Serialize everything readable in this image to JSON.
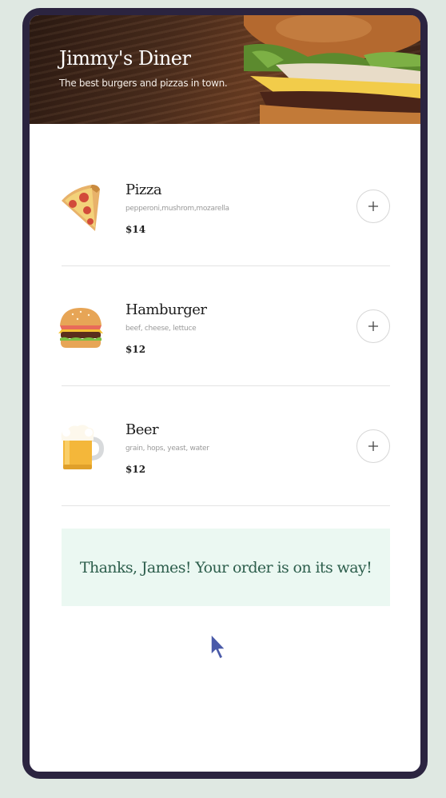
{
  "restaurant": {
    "name": "Jimmy's Diner",
    "tagline": "The best burgers and pizzas in town."
  },
  "menu": [
    {
      "name": "Pizza",
      "ingredients": "pepperoni,mushrom,mozarella",
      "price": "$14",
      "icon": "pizza-icon"
    },
    {
      "name": "Hamburger",
      "ingredients": "beef, cheese, lettuce",
      "price": "$12",
      "icon": "hamburger-icon"
    },
    {
      "name": "Beer",
      "ingredients": "grain, hops, yeast, water",
      "price": "$12",
      "icon": "beer-icon"
    }
  ],
  "add_button_icon": "plus-icon",
  "confirmation": {
    "message": "Thanks, James! Your order is on its way!"
  },
  "colors": {
    "frame": "#2b2440",
    "page_background": "#dfe8e2",
    "confirmation_background": "#ebf8f2",
    "confirmation_text": "#2d5e4c"
  }
}
